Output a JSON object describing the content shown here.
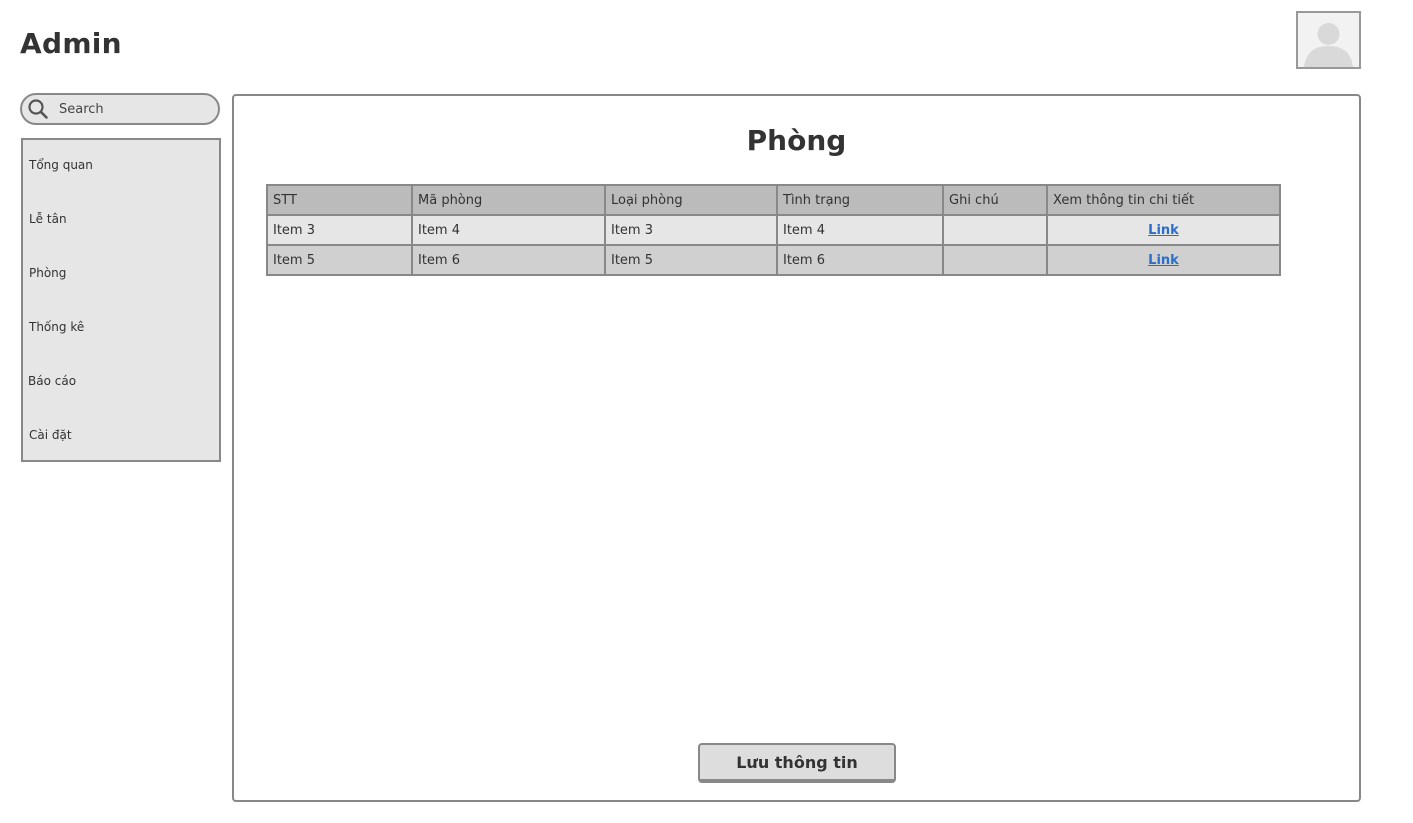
{
  "header": {
    "title": "Admin",
    "avatar_icon": "user-avatar-icon"
  },
  "search": {
    "placeholder": "Search",
    "icon": "search-icon"
  },
  "sidebar": {
    "items": [
      {
        "label": "Tổng quan"
      },
      {
        "label": "Lễ tân"
      },
      {
        "label": "Phòng"
      },
      {
        "label": "Thống kê"
      },
      {
        "label": "Báo cáo"
      },
      {
        "label": "Cài đặt"
      }
    ]
  },
  "main": {
    "title": "Phòng",
    "table": {
      "columns": [
        "STT",
        "Mã phòng",
        "Loại phòng",
        "Tình trạng",
        "Ghi chú",
        "Xem thông tin chi tiết"
      ],
      "rows": [
        [
          "Item 3",
          "Item 4",
          "Item 3",
          "Item 4",
          "",
          "Link"
        ],
        [
          "Item 5",
          "Item 6",
          "Item 5",
          "Item 6",
          "",
          "Link"
        ]
      ]
    },
    "save_label": "Lưu thông tin"
  },
  "colors": {
    "border": "#888888",
    "panel_bg": "#e6e6e6",
    "header_bg": "#bbbbbb",
    "alt_row_bg": "#d0d0d0",
    "link": "#2a6fc9"
  }
}
